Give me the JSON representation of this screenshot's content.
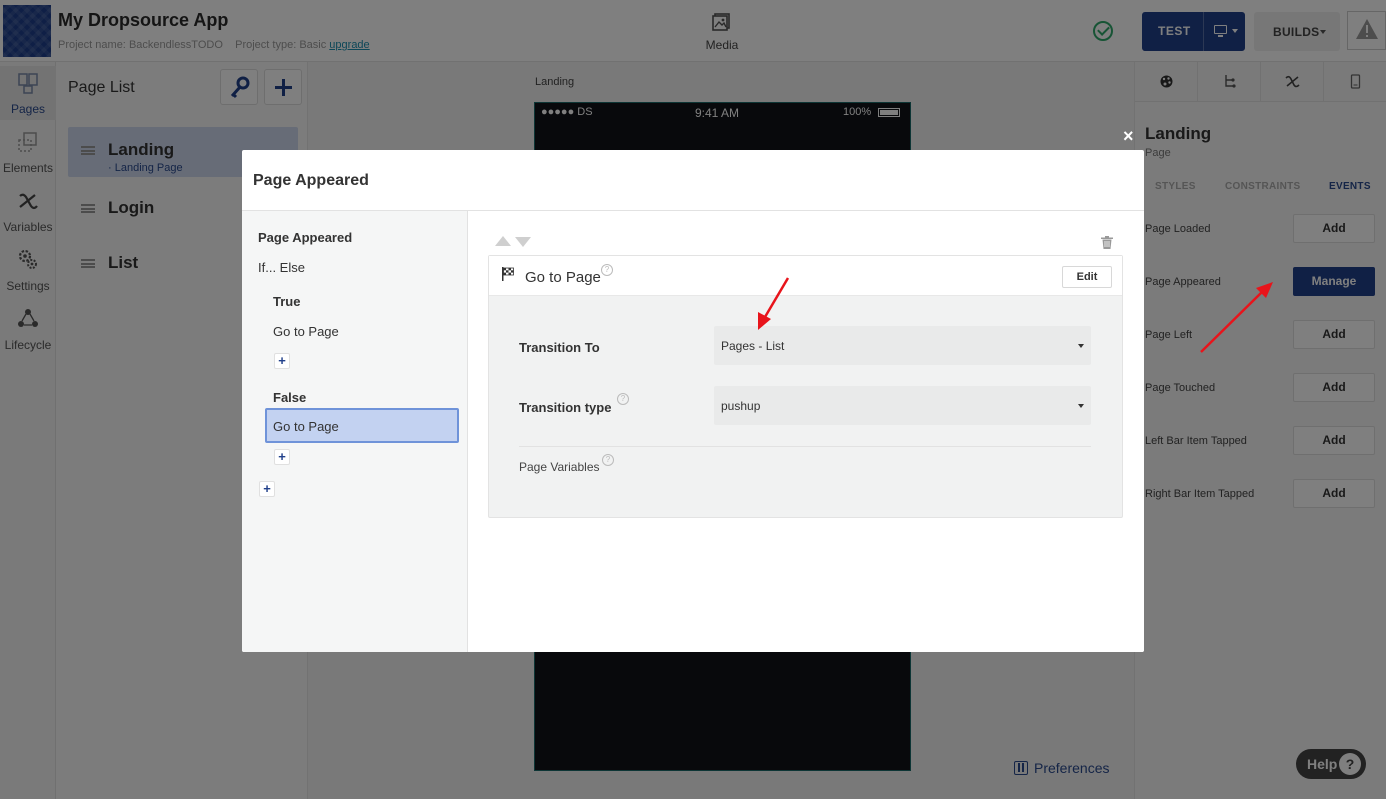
{
  "header": {
    "app_title": "My Dropsource App",
    "project_name_label": "Project name:",
    "project_name": "BackendlessTODO",
    "project_type_label": "Project type:",
    "project_type": "Basic",
    "upgrade_label": "upgrade",
    "media_label": "Media",
    "test_label": "TEST",
    "builds_label": "BUILDS"
  },
  "left_rail": {
    "items": [
      {
        "label": "Pages",
        "icon": "pages-icon",
        "active": true
      },
      {
        "label": "Elements",
        "icon": "elements-icon"
      },
      {
        "label": "Variables",
        "icon": "variables-icon"
      },
      {
        "label": "Settings",
        "icon": "settings-icon"
      },
      {
        "label": "Lifecycle",
        "icon": "lifecycle-icon"
      }
    ]
  },
  "page_list": {
    "title": "Page List",
    "pages": [
      {
        "name": "Landing",
        "subtitle": "· Landing Page",
        "active": true
      },
      {
        "name": "Login"
      },
      {
        "name": "List"
      }
    ],
    "more_glyph": "•••"
  },
  "canvas": {
    "page_label": "Landing",
    "status_bar": {
      "carrier": "●●●●● DS",
      "time": "9:41 AM",
      "battery": "100%"
    },
    "preferences_label": "Preferences"
  },
  "right_panel": {
    "component_name": "Landing",
    "component_type": "Page",
    "sub_tabs": [
      "STYLES",
      "CONSTRAINTS",
      "EVENTS"
    ],
    "active_sub_tab": "EVENTS",
    "events": [
      {
        "label": "Page Loaded",
        "button": "Add"
      },
      {
        "label": "Page Appeared",
        "button": "Manage"
      },
      {
        "label": "Page Left",
        "button": "Add"
      },
      {
        "label": "Page Touched",
        "button": "Add"
      },
      {
        "label": "Left Bar Item Tapped",
        "button": "Add"
      },
      {
        "label": "Right Bar Item Tapped",
        "button": "Add"
      }
    ]
  },
  "modal": {
    "title": "Page Appeared",
    "tree": {
      "root": "Page Appeared",
      "condition": "If... Else",
      "true_label": "True",
      "true_action": "Go to Page",
      "false_label": "False",
      "false_action": "Go to Page",
      "add_glyph": "+"
    },
    "action": {
      "title": "Go to Page",
      "edit_label": "Edit",
      "transition_to_label": "Transition To",
      "transition_to_value": "Pages - List",
      "transition_type_label": "Transition type",
      "transition_type_value": "pushup",
      "page_variables_label": "Page Variables"
    },
    "close_glyph": "×"
  },
  "help": {
    "label": "Help",
    "glyph": "?"
  },
  "colors": {
    "brand": "#21408b",
    "annotation_arrow": "#e8141b",
    "selection": "#c3d2f1",
    "success": "#2fa86b"
  }
}
